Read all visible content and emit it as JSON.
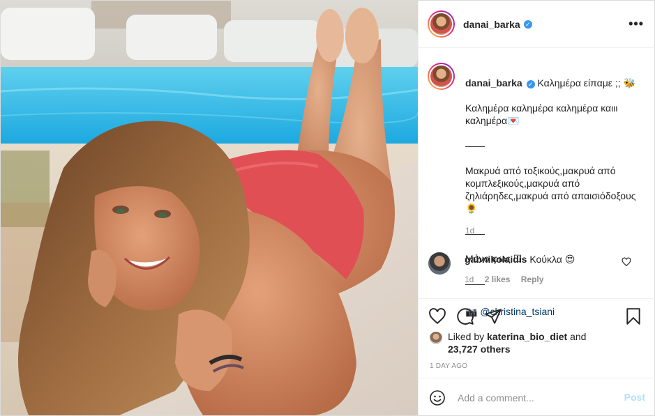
{
  "header": {
    "username": "danai_barka",
    "verified_icon": "verified-badge-icon",
    "more_icon": "more-options-icon"
  },
  "caption": {
    "username": "danai_barka",
    "lines": [
      "Καλημέρα είπαμε ;; 🐝",
      "Καλημέρα καλημέρα καλημέρα καιιι καλημέρα💌",
      "——",
      "Μακρυά από τοξικούς,μακρυά από κομπλεξικούς,μακρυά από ζηλιάρηδες,μακρυά από απαισιόδοξους 🌻",
      "——",
      "Μόνο φως ☐",
      "——"
    ],
    "credit_prefix": "📷",
    "credit_mention": "@christina_tsiani",
    "time": "1d"
  },
  "comment": {
    "username": "gabnikolaidis",
    "text": "Κούκλα 😍",
    "time": "1d",
    "likes": "2 likes",
    "reply_label": "Reply"
  },
  "likes": {
    "prefix": "Liked by",
    "user": "katerina_bio_diet",
    "joiner": "and",
    "others": "23,727 others"
  },
  "timestamp": "1 DAY AGO",
  "add_comment": {
    "placeholder": "Add a comment...",
    "post_label": "Post"
  },
  "colors": {
    "accent": "#3897f0",
    "post_disabled": "#b2dffc",
    "muted": "#8e8e8e",
    "text": "#262626"
  }
}
